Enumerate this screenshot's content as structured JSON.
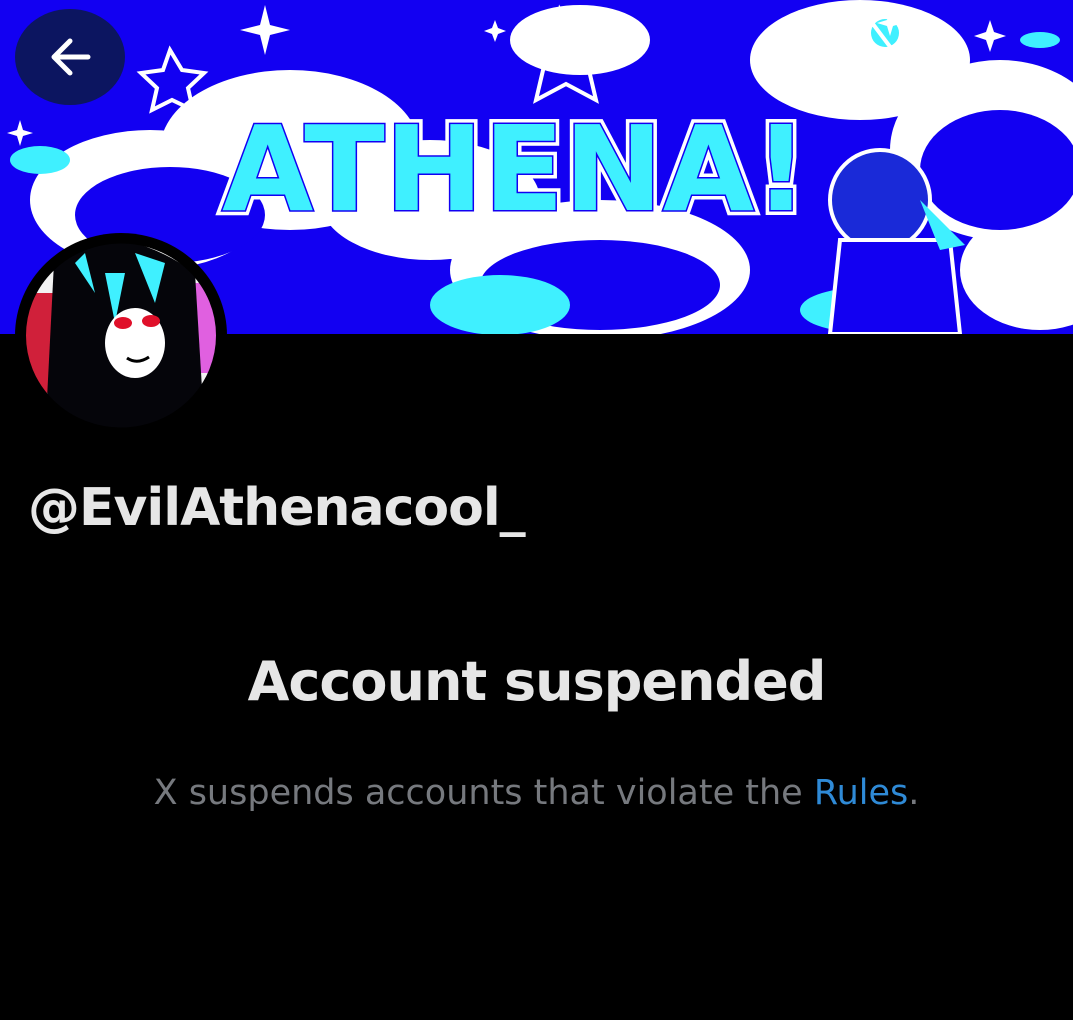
{
  "header": {
    "back_icon": "arrow-left-icon",
    "banner_text": "ATHENA!"
  },
  "profile": {
    "handle": "@EvilAthenacool_"
  },
  "suspension": {
    "title": "Account suspended",
    "message_prefix": "X suspends accounts that violate the ",
    "rules_link": "Rules",
    "message_suffix": "."
  },
  "colors": {
    "background": "#000000",
    "banner_blue": "#1200f2",
    "banner_cyan": "#3ff0ff",
    "text_primary": "#e6e6e6",
    "text_secondary": "#76797e",
    "link": "#2f8ad6"
  }
}
